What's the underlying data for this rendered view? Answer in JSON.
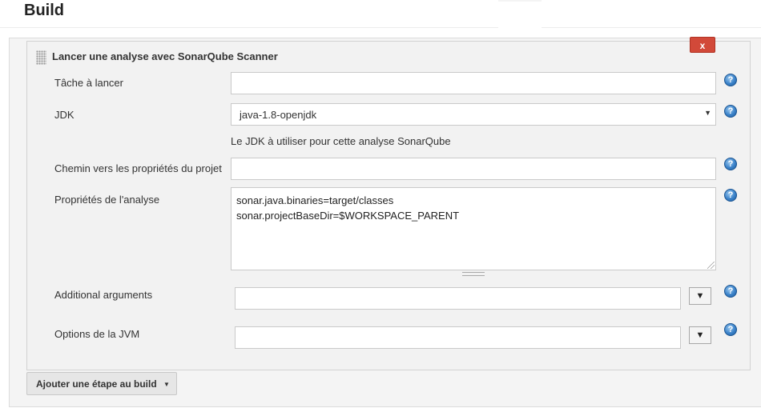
{
  "header": {
    "title": "Build"
  },
  "step": {
    "title": "Lancer une analyse avec SonarQube Scanner",
    "delete_label": "x"
  },
  "fields": {
    "task": {
      "label": "Tâche à lancer",
      "value": ""
    },
    "jdk": {
      "label": "JDK",
      "selected": "java-1.8-openjdk",
      "arrow": "▼",
      "help_text": "Le JDK à utiliser pour cette analyse SonarQube"
    },
    "properties_path": {
      "label": "Chemin vers les propriétés du projet",
      "value": ""
    },
    "analysis_properties": {
      "label": "Propriétés de l'analyse",
      "lines": [
        "sonar.java.binaries=target/classes",
        "sonar.projectBaseDir=$WORKSPACE_PARENT"
      ]
    },
    "additional_args": {
      "label": "Additional arguments",
      "value": "",
      "dropdown": "▼"
    },
    "jvm_options": {
      "label": "Options de la JVM",
      "value": "",
      "dropdown": "▼"
    }
  },
  "help_icon_glyph": "?",
  "footer": {
    "add_step_label": "Ajouter une étape au build",
    "caret": "▼"
  },
  "colors": {
    "delete_button": "#d24939",
    "help_icon": "#3b82c9",
    "panel_bg": "#f2f2f2"
  }
}
